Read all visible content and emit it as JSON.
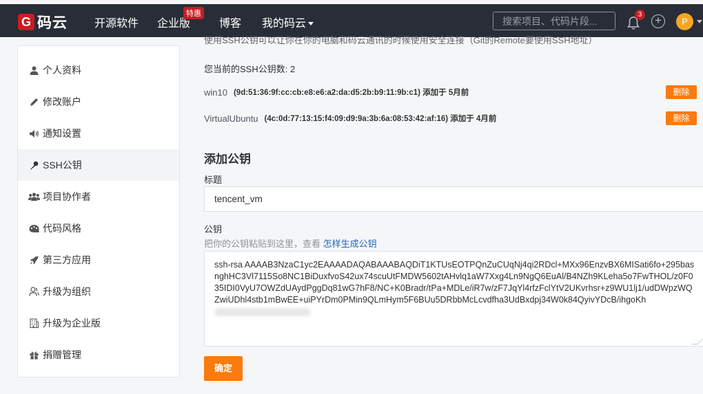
{
  "header": {
    "logo_letter": "G",
    "logo_text": "码云",
    "nav": [
      "开源软件",
      "企业版",
      "博客",
      "我的码云"
    ],
    "enterprise_badge": "特惠",
    "search_placeholder": "搜索项目、代码片段...",
    "notification_count": "3",
    "avatar_letter": "P"
  },
  "sidebar": {
    "items": [
      {
        "label": "个人资料",
        "icon": "user-icon"
      },
      {
        "label": "修改账户",
        "icon": "pencil-icon"
      },
      {
        "label": "通知设置",
        "icon": "speaker-icon"
      },
      {
        "label": "SSH公钥",
        "icon": "key-icon",
        "active": true
      },
      {
        "label": "项目协作者",
        "icon": "users-icon"
      },
      {
        "label": "代码风格",
        "icon": "palette-icon"
      },
      {
        "label": "第三方应用",
        "icon": "rocket-icon"
      },
      {
        "label": "升级为组织",
        "icon": "org-icon"
      },
      {
        "label": "升级为企业版",
        "icon": "building-icon"
      },
      {
        "label": "捐赠管理",
        "icon": "gift-icon"
      }
    ]
  },
  "main": {
    "intro": "使用SSH公钥可以让你在你的电脑和码云通讯的时候使用安全连接（Git的Remote要使用SSH地址）",
    "key_count": "您当前的SSH公钥数: 2",
    "keys": [
      {
        "name": "win10",
        "fingerprint": "(9d:51:36:9f:cc:cb:e8:e6:a2:da:d5:2b:b9:11:9b:c1) 添加于 5月前",
        "delete_label": "删除"
      },
      {
        "name": "VirtualUbuntu",
        "fingerprint": "(4c:0d:77:13:15:f4:09:d9:9a:3b:6a:08:53:42:af:16) 添加于 4月前",
        "delete_label": "删除"
      }
    ],
    "add_title": "添加公钥",
    "title_label": "标题",
    "title_value": "tencent_vm",
    "key_label": "公钥",
    "hint_text": "把你的公钥粘贴到这里，查看 ",
    "hint_link": "怎样生成公钥",
    "key_value": "ssh-rsa AAAAB3NzaC1yc2EAAAADAQABAAABAQDiT1KTUsEOTPQnZuCUqNj4qi2RDcl+MXx96EnzvBX6MISati6fo+295basnghHC3Vl7115So8NC1BiDuxfvoS42ux74scuUtFMDW5602tAHvlq1aW7Xxg4Ln9NgQ6EuAl/B4NZh9KLeha5o7FwTHOL/z0F035IDI0VyU7OWZdUAydPggDq81wG7hF8/NC+K0Bradr/tPa+MDLe/iR7w/zF7JqYl4rfzFclYtV2UKvrhsr+z9WU1lj1/udDWpzWQZwiUDhl4stb1mBwEE+uiPYrDm0PMin9QLmHym5F6BUu5DRbbMcLcvdfha3UdBxdpj34W0k84QyivYDcB/ihgoKh",
    "confirm_label": "确定"
  }
}
